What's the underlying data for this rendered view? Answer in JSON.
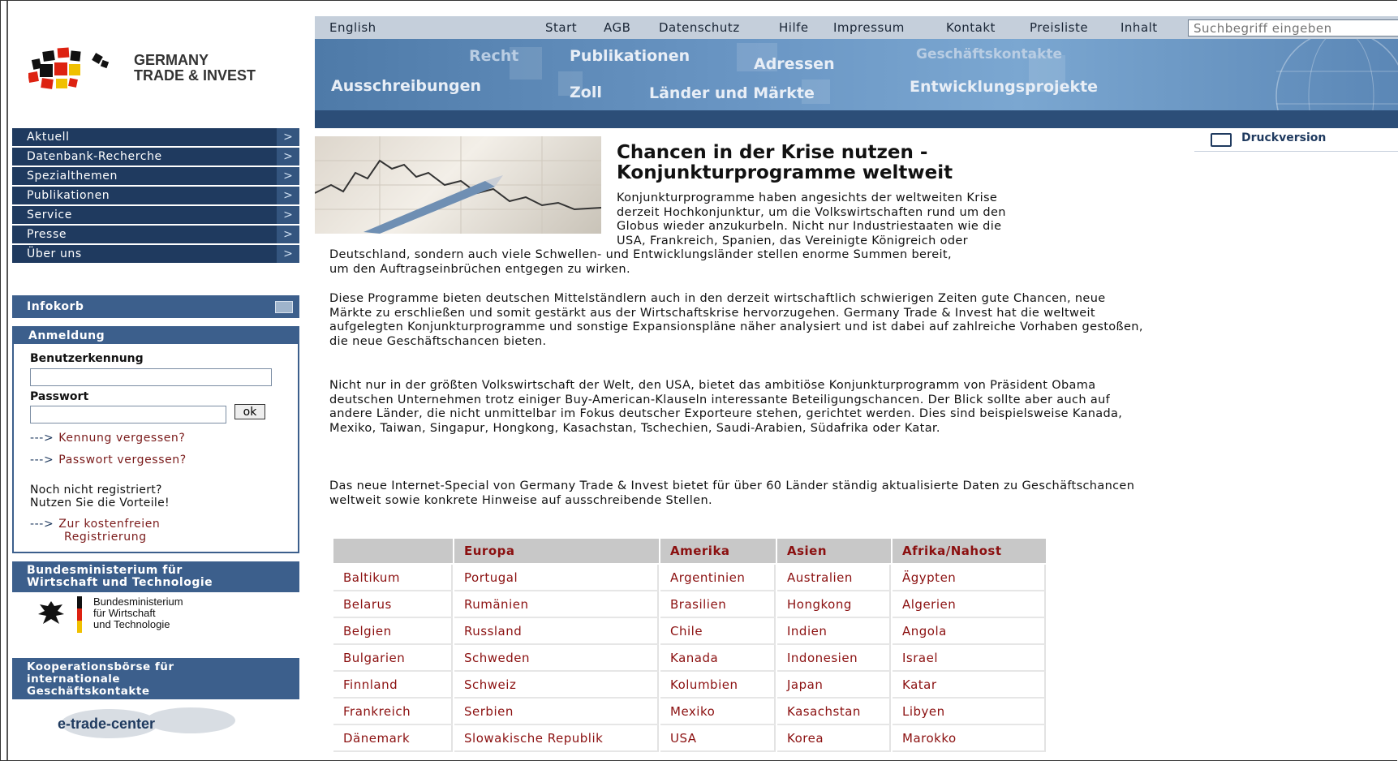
{
  "brand": {
    "line1": "GERMANY",
    "line2": "TRADE & INVEST"
  },
  "topbar": {
    "language": "English",
    "links": [
      "Start",
      "AGB",
      "Datenschutz",
      "Hilfe",
      "Impressum",
      "Kontakt",
      "Preisliste",
      "Inhalt"
    ],
    "search_placeholder": "Suchbegriff eingeben"
  },
  "banner": {
    "recht": "Recht",
    "publikationen": "Publikationen",
    "adressen": "Adressen",
    "geschaeftskontakte": "Geschäftskontakte",
    "ausschreibungen": "Ausschreibungen",
    "zoll": "Zoll",
    "laender": "Länder und Märkte",
    "entwicklung": "Entwicklungsprojekte"
  },
  "sidebar": {
    "items": [
      "Aktuell",
      "Datenbank-Recherche",
      "Spezialthemen",
      "Publikationen",
      "Service",
      "Presse",
      "Über uns"
    ],
    "arrow": ">",
    "infokorb": "Infokorb",
    "anmeldung": "Anmeldung",
    "user_label": "Benutzerkennung",
    "pass_label": "Passwort",
    "ok": "ok",
    "forgot_id": "Kennung vergessen?",
    "forgot_pw": "Passwort vergessen?",
    "link_arrow": "--->",
    "not_registered_1": "Noch nicht registriert?",
    "not_registered_2": "Nutzen Sie die Vorteile!",
    "register_1": "Zur kostenfreien",
    "register_2": "Registrierung",
    "bmwi_head_1": "Bundesministerium für",
    "bmwi_head_2": "Wirtschaft und Technologie",
    "bmwi_logo_1": "Bundesministerium",
    "bmwi_logo_2": "für Wirtschaft",
    "bmwi_logo_3": "und Technologie",
    "koop_1": "Kooperationsbörse für",
    "koop_2": "internationale",
    "koop_3": "Geschäftskontakte",
    "etrade": "e-trade-center"
  },
  "main": {
    "print": "Druckversion",
    "title_1": "Chancen in der Krise nutzen -",
    "title_2": "Konjunkturprogramme weltweit",
    "intro_1": "Konjunkturprogramme haben angesichts der weltweiten Krise",
    "intro_2": "derzeit Hochkonjunktur, um die Volkswirtschaften rund um den",
    "intro_3": "Globus wieder anzukurbeln. Nicht nur Industriestaaten wie die",
    "intro_4": "USA, Frankreich, Spanien, das Vereinigte Königreich oder",
    "intro_5": "Deutschland, sondern auch viele Schwellen- und Entwicklungsländer stellen enorme Summen bereit,",
    "intro_6": "um den Auftragseinbrüchen entgegen zu wirken.",
    "p2": "Diese Programme bieten deutschen Mittelständlern auch in den derzeit wirtschaftlich schwierigen Zeiten gute Chancen, neue Märkte zu erschließen und somit gestärkt aus der Wirtschaftskrise hervorzugehen. Germany Trade & Invest hat die weltweit aufgelegten Konjunkturprogramme und sonstige Expansionspläne näher analysiert und ist dabei auf zahlreiche Vorhaben gestoßen, die neue Geschäftschancen bieten.",
    "p3": "Nicht nur in der größten Volkswirtschaft der Welt, den USA, bietet das ambitiöse Konjunkturprogramm von Präsident Obama deutschen Unternehmen trotz einiger Buy-American-Klauseln interessante Beteiligungschancen. Der Blick sollte aber auch auf andere Länder, die nicht unmittelbar im Fokus deutscher Exporteure stehen, gerichtet werden. Dies sind beispielsweise Kanada, Mexiko, Taiwan, Singapur, Hongkong, Kasachstan, Tschechien, Saudi-Arabien, Südafrika oder Katar.",
    "p4": "Das neue Internet-Special von Germany Trade & Invest bietet für über 60 Länder ständig aktualisierte Daten zu Geschäftschancen weltweit sowie konkrete Hinweise auf ausschreibende Stellen."
  },
  "table": {
    "headers": [
      "",
      "Europa",
      "Amerika",
      "Asien",
      "Afrika/Nahost"
    ],
    "rows": [
      [
        "Baltikum",
        "Portugal",
        "Argentinien",
        "Australien",
        "Ägypten"
      ],
      [
        "Belarus",
        "Rumänien",
        "Brasilien",
        "Hongkong",
        "Algerien"
      ],
      [
        "Belgien",
        "Russland",
        "Chile",
        "Indien",
        "Angola"
      ],
      [
        "Bulgarien",
        "Schweden",
        "Kanada",
        "Indonesien",
        "Israel"
      ],
      [
        "Finnland",
        "Schweiz",
        "Kolumbien",
        "Japan",
        "Katar"
      ],
      [
        "Frankreich",
        "Serbien",
        "Mexiko",
        "Kasachstan",
        "Libyen"
      ],
      [
        "Dänemark",
        "Slowakische Republik",
        "USA",
        "Korea",
        "Marokko"
      ]
    ]
  },
  "colors": {
    "nav": "#1f3a5f",
    "banner": "#5b87b6",
    "link": "#8b1010"
  }
}
